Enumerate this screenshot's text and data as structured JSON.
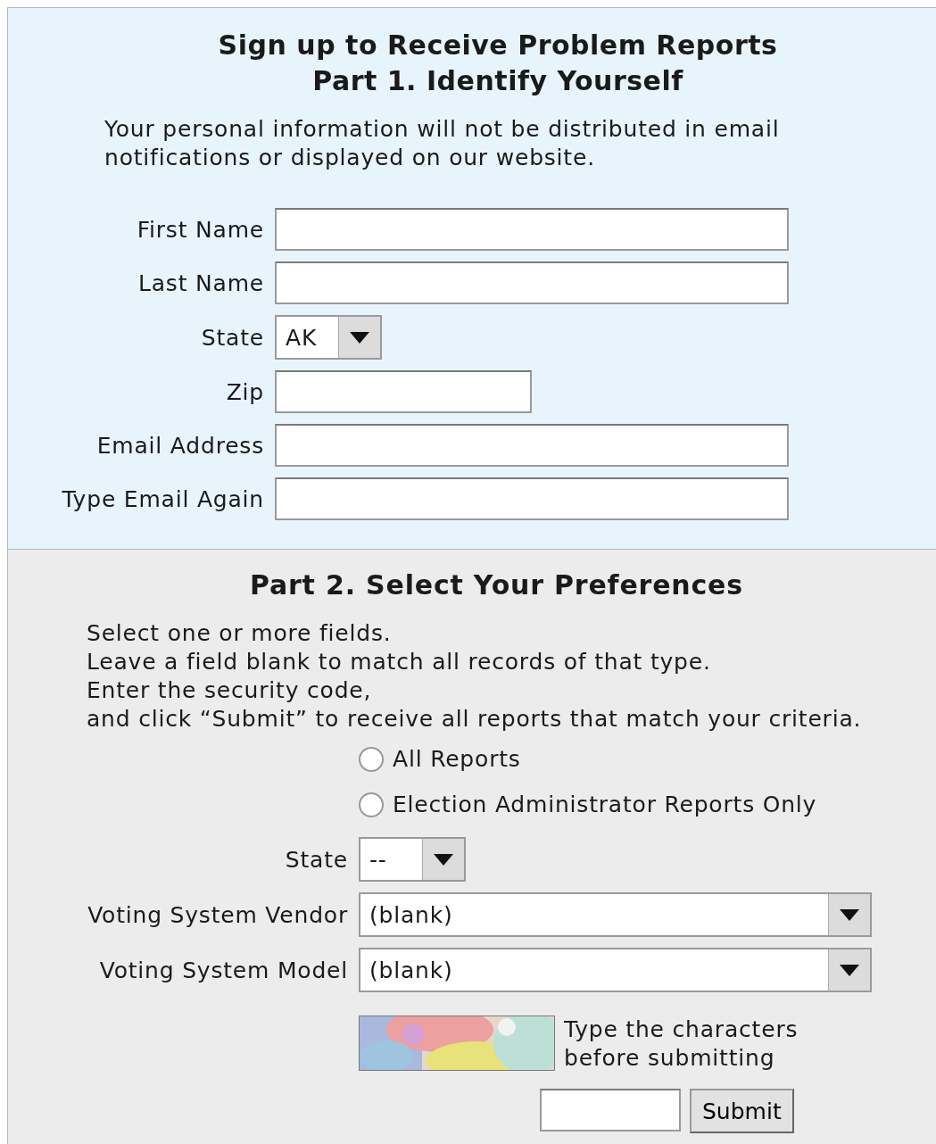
{
  "part1": {
    "title": [
      "Sign up to Receive Problem Reports",
      "Part 1. Identify Yourself"
    ],
    "note": "Your personal information will not be distributed in email notifications or displayed on our website.",
    "fields": [
      {
        "label": "First Name",
        "kind": "text"
      },
      {
        "label": "Last Name",
        "kind": "text"
      },
      {
        "label": "State",
        "kind": "select",
        "value": "AK"
      },
      {
        "label": "Zip",
        "kind": "text"
      },
      {
        "label": "Email Address",
        "kind": "text"
      },
      {
        "label": "Type Email Again",
        "kind": "text"
      }
    ]
  },
  "part2": {
    "title": "Part 2. Select Your Preferences",
    "instructions": [
      "Select one or more fields.",
      "Leave a field blank to match all records of that type.",
      "Enter the security code,",
      "and click “Submit” to receive all reports that match your criteria."
    ],
    "report_types": [
      {
        "label": "All Reports",
        "selected": false
      },
      {
        "label": "Election Administrator Reports Only",
        "selected": false
      }
    ],
    "fields": [
      {
        "label": "State",
        "kind": "select",
        "value": "--"
      },
      {
        "label": "Voting System Vendor",
        "kind": "select",
        "value": "(blank)"
      },
      {
        "label": "Voting System Model",
        "kind": "select",
        "value": "(blank)"
      }
    ],
    "captcha": {
      "kind": "picture",
      "caption": [
        "Type the characters",
        "before submitting"
      ]
    },
    "submit": "Submit"
  }
}
